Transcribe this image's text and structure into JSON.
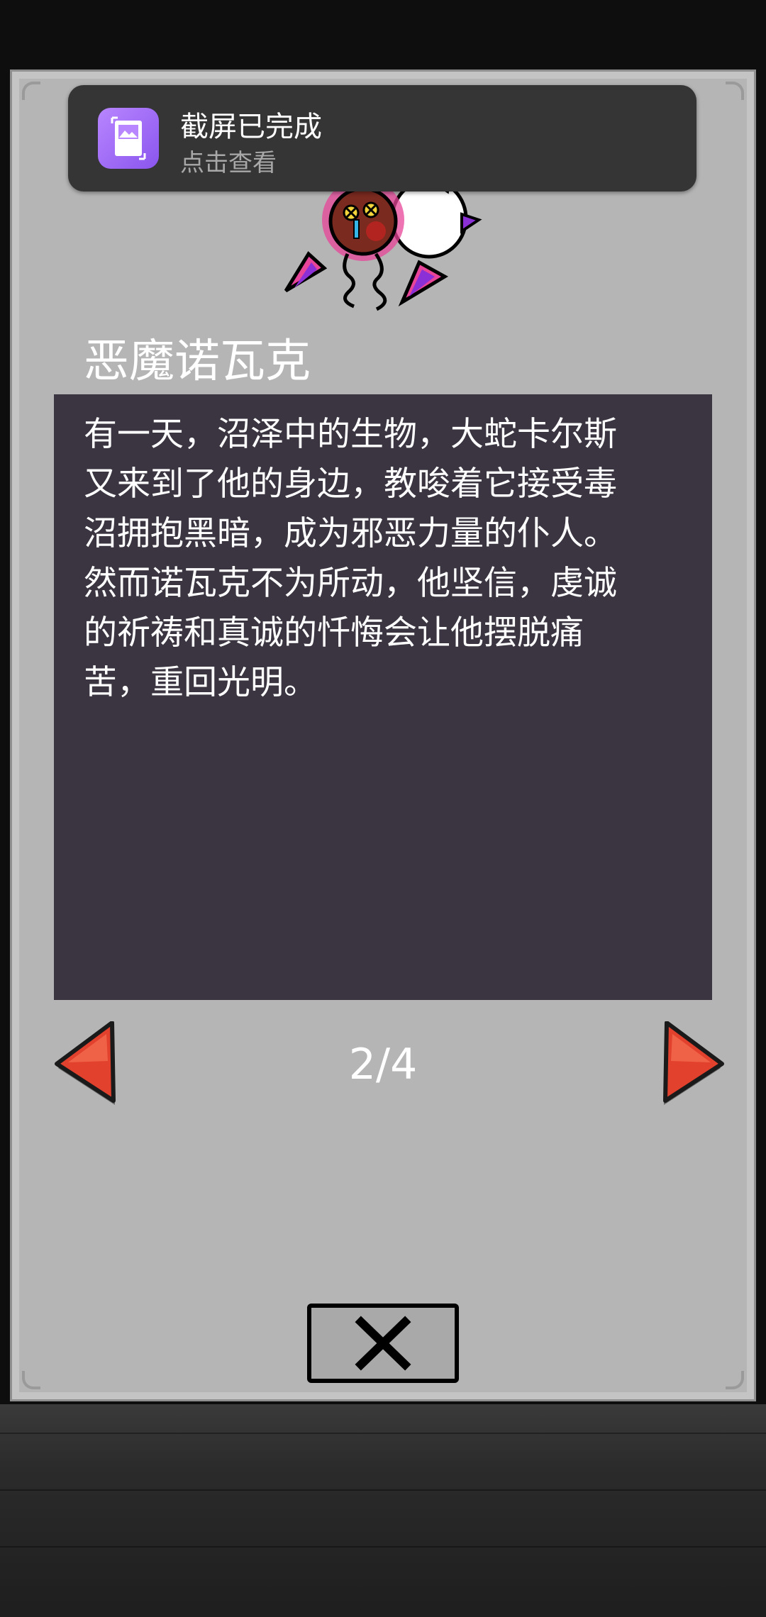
{
  "notification": {
    "title": "截屏已完成",
    "subtitle": "点击查看",
    "icon": "screenshot-gallery-icon",
    "icon_color": "#a36ff8"
  },
  "character": {
    "name": "恶魔诺瓦克",
    "image": "demon-creature-sprite"
  },
  "story": {
    "text": "有一天，沼泽中的生物，大蛇卡尔斯\n又来到了他的身边，教唆着它接受毒\n沼拥抱黑暗，成为邪恶力量的仆人。\n然而诺瓦克不为所动，他坚信，虔诚\n的祈祷和真诚的忏悔会让他摆脱痛\n苦，重回光明。"
  },
  "pagination": {
    "current_label": "2/4",
    "prev_icon": "left-arrow-icon",
    "next_icon": "right-arrow-icon"
  },
  "close": {
    "icon": "close-x-icon"
  },
  "colors": {
    "panel": "#b5b5b5",
    "story_box": "#3b3541",
    "arrow_red": "#e2412d",
    "notification_bg": "#353535"
  }
}
